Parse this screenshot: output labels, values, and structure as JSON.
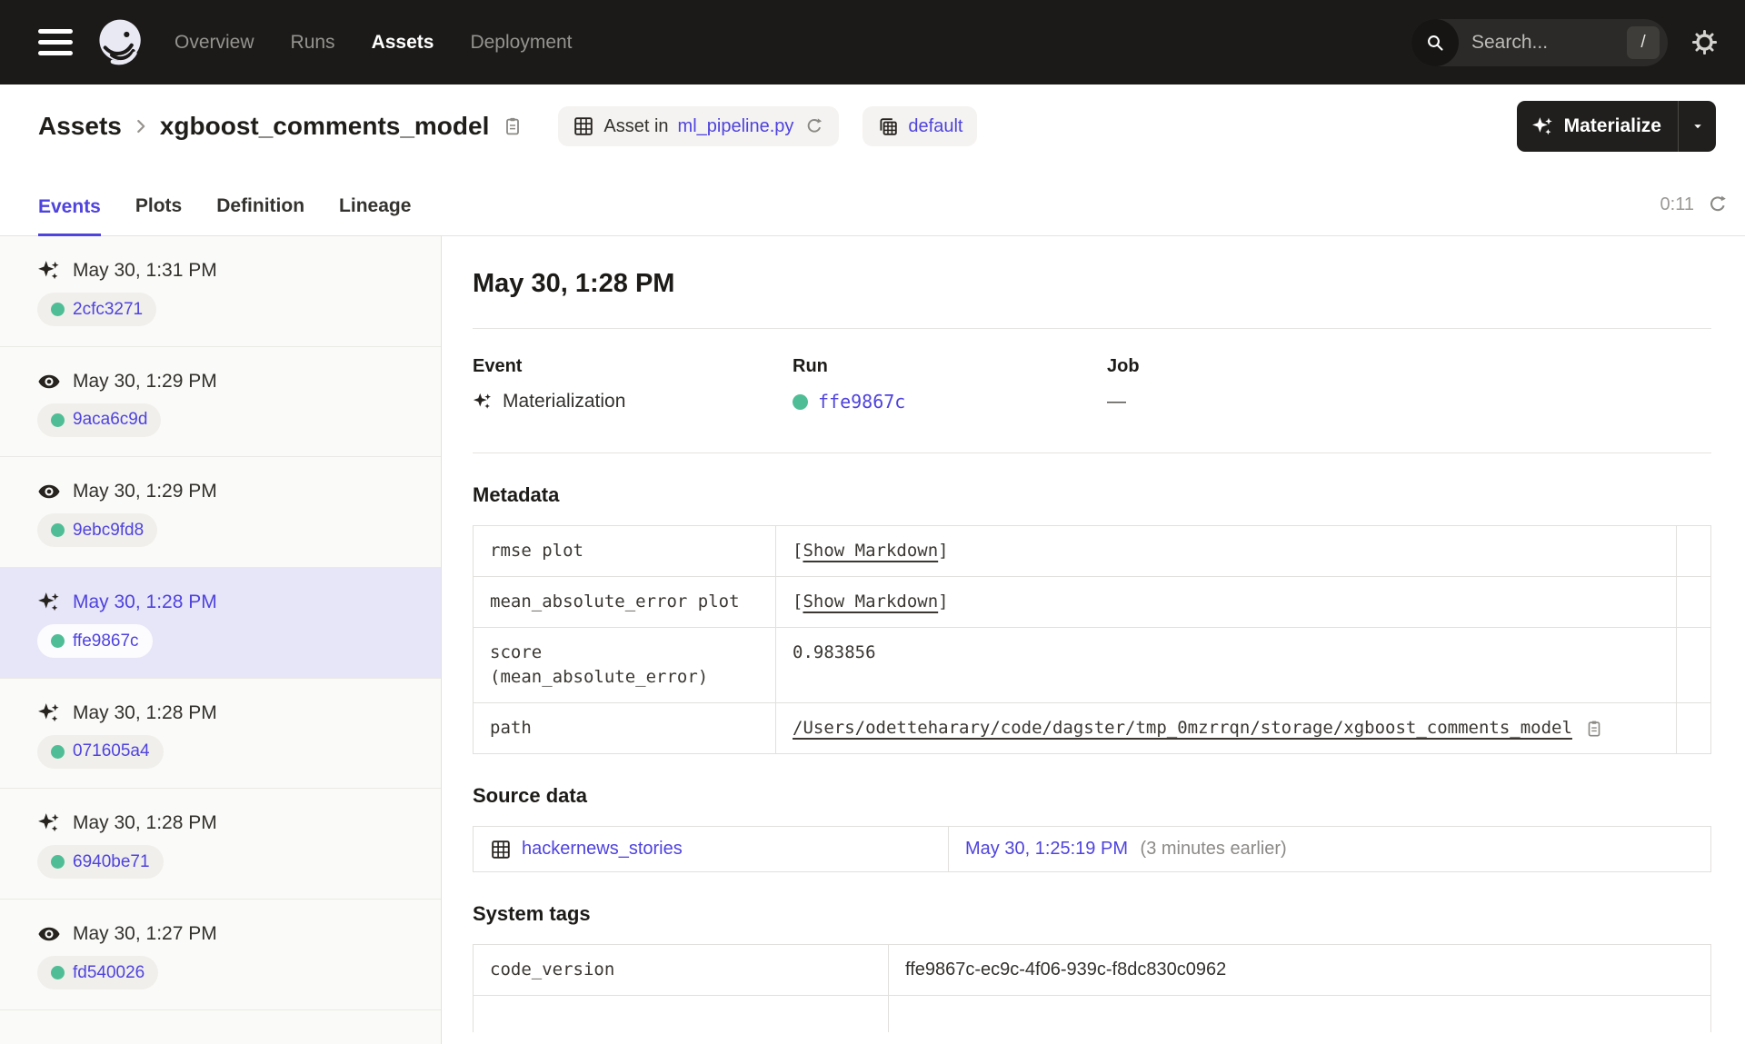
{
  "colors": {
    "accent": "#4F43DD",
    "success_green": "#4FBE96",
    "nav_bg": "#1B1A18"
  },
  "nav": {
    "items": [
      {
        "label": "Overview"
      },
      {
        "label": "Runs"
      },
      {
        "label": "Assets"
      },
      {
        "label": "Deployment"
      }
    ],
    "active": "Assets",
    "search": {
      "placeholder": "Search...",
      "shortcut": "/"
    }
  },
  "header": {
    "breadcrumb": {
      "root": "Assets",
      "title": "xgboost_comments_model"
    },
    "code_location_badge": {
      "prefix": "Asset in",
      "link": "ml_pipeline.py"
    },
    "group_badge": {
      "label": "default"
    },
    "materialize": {
      "label": "Materialize"
    }
  },
  "tabs": {
    "items": [
      {
        "label": "Events"
      },
      {
        "label": "Plots"
      },
      {
        "label": "Definition"
      },
      {
        "label": "Lineage"
      }
    ],
    "active": "Events",
    "timer": "0:11"
  },
  "sidebar": {
    "events": [
      {
        "time": "May 30, 1:31 PM",
        "type": "materialization",
        "run_id": "2cfc3271",
        "selected": false
      },
      {
        "time": "May 30, 1:29 PM",
        "type": "observation",
        "run_id": "9aca6c9d",
        "selected": false
      },
      {
        "time": "May 30, 1:29 PM",
        "type": "observation",
        "run_id": "9ebc9fd8",
        "selected": false
      },
      {
        "time": "May 30, 1:28 PM",
        "type": "materialization",
        "run_id": "ffe9867c",
        "selected": true
      },
      {
        "time": "May 30, 1:28 PM",
        "type": "materialization",
        "run_id": "071605a4",
        "selected": false
      },
      {
        "time": "May 30, 1:28 PM",
        "type": "materialization",
        "run_id": "6940be71",
        "selected": false
      },
      {
        "time": "May 30, 1:27 PM",
        "type": "observation",
        "run_id": "fd540026",
        "selected": false
      }
    ]
  },
  "detail": {
    "title": "May 30, 1:28 PM",
    "event": {
      "label": "Event",
      "value": "Materialization"
    },
    "run": {
      "label": "Run",
      "value": "ffe9867c"
    },
    "job": {
      "label": "Job",
      "value": "—"
    },
    "metadata": {
      "heading": "Metadata",
      "rows": [
        {
          "key": "rmse plot",
          "open": "[",
          "label": "Show Markdown",
          "close": "]"
        },
        {
          "key": "mean_absolute_error plot",
          "open": "[",
          "label": "Show Markdown",
          "close": "]"
        },
        {
          "key": "score\n(mean_absolute_error)",
          "value": "0.983856"
        },
        {
          "key": "path",
          "value": "/Users/odetteharary/code/dagster/tmp_0mzrrqn/storage/xgboost_comments_model"
        }
      ]
    },
    "source_data": {
      "heading": "Source data",
      "asset": "hackernews_stories",
      "timestamp": "May 30, 1:25:19 PM",
      "note": "(3 minutes earlier)"
    },
    "system_tags": {
      "heading": "System tags",
      "rows": [
        {
          "key": "code_version",
          "value": "ffe9867c-ec9c-4f06-939c-f8dc830c0962"
        }
      ]
    }
  }
}
